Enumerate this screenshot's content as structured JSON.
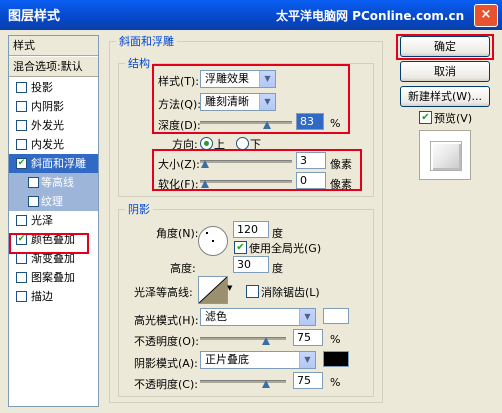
{
  "window": {
    "title": "图层样式",
    "watermark": "太平洋电脑网 PConline.com.cn",
    "close": "×"
  },
  "left_panel": {
    "header": "样式",
    "blend_options": "混合选项:默认",
    "items": [
      {
        "label": "投影",
        "checked": false
      },
      {
        "label": "内阴影",
        "checked": false
      },
      {
        "label": "外发光",
        "checked": false
      },
      {
        "label": "内发光",
        "checked": false
      },
      {
        "label": "斜面和浮雕",
        "checked": true,
        "selected": true
      },
      {
        "label": "等高线",
        "checked": false,
        "sub": true
      },
      {
        "label": "纹理",
        "checked": false,
        "sub": true
      },
      {
        "label": "光泽",
        "checked": false
      },
      {
        "label": "颜色叠加",
        "checked": true
      },
      {
        "label": "渐变叠加",
        "checked": false
      },
      {
        "label": "图案叠加",
        "checked": false
      },
      {
        "label": "描边",
        "checked": false
      }
    ]
  },
  "bevel": {
    "title": "斜面和浮雕",
    "structure": {
      "title": "结构",
      "style_label": "样式(T):",
      "style_value": "浮雕效果",
      "method_label": "方法(Q):",
      "method_value": "雕刻清晰",
      "depth_label": "深度(D):",
      "depth_value": "83",
      "depth_unit": "%",
      "direction_label": "方向:",
      "dir_up": "上",
      "dir_down": "下",
      "size_label": "大小(Z):",
      "size_value": "3",
      "size_unit": "像素",
      "soften_label": "软化(F):",
      "soften_value": "0",
      "soften_unit": "像素"
    },
    "shading": {
      "title": "阴影",
      "angle_label": "角度(N):",
      "angle_value": "120",
      "angle_unit": "度",
      "global_light": "使用全局光(G)",
      "altitude_label": "高度:",
      "altitude_value": "30",
      "altitude_unit": "度",
      "gloss_label": "光泽等高线:",
      "antialias": "消除锯齿(L)",
      "highlight_label": "高光模式(H):",
      "highlight_value": "滤色",
      "highlight_opacity_label": "不透明度(O):",
      "highlight_opacity": "75",
      "highlight_opacity_unit": "%",
      "shadow_label": "阴影模式(A):",
      "shadow_value": "正片叠底",
      "shadow_opacity_label": "不透明度(C):",
      "shadow_opacity": "75",
      "shadow_opacity_unit": "%"
    }
  },
  "buttons": {
    "ok": "确定",
    "cancel": "取消",
    "new_style": "新建样式(W)...",
    "preview": "预览(V)"
  },
  "colors": {
    "accent": "#e4001b",
    "titlebar": "#0548c9",
    "highlight_color": "#ffffff",
    "shadow_color": "#000000"
  }
}
